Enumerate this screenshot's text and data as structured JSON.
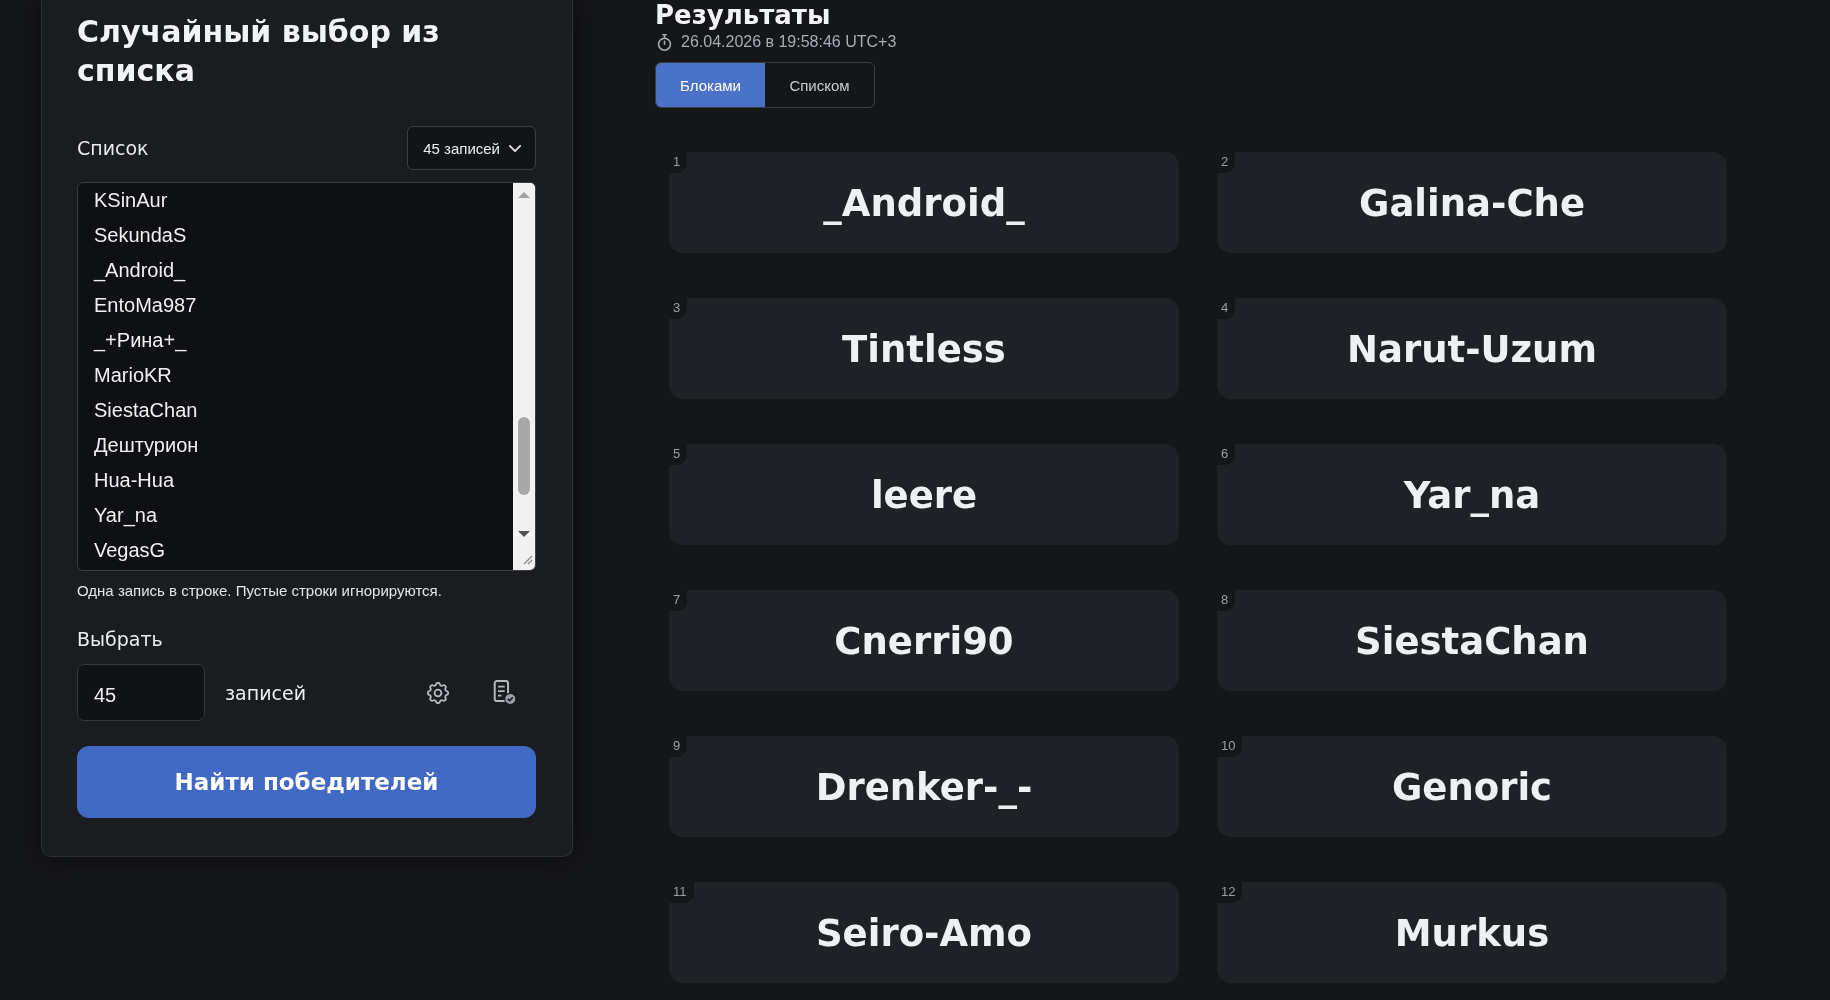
{
  "panel": {
    "title": "Случайный выбор из списка",
    "list_label": "Список",
    "count_dropdown": "45 записей",
    "entries": [
      "KSinAur",
      "SekundaS",
      "_Android_",
      "EntoMa987",
      "_+Рина+_",
      "MarioKR",
      "SiestaChan",
      "Дештурион",
      "Hua-Hua",
      "Yar_na",
      "VegasG"
    ],
    "hint": "Одна запись в строке. Пустые строки игнорируются.",
    "pick_label": "Выбрать",
    "pick_count": {
      "value": "45"
    },
    "pick_unit": "записей",
    "submit_button": "Найти победителей"
  },
  "results": {
    "title": "Результаты",
    "timestamp": "26.04.2026 в 19:58:46 UTC+3",
    "view_tabs": [
      {
        "label": "Блоками",
        "selected": true
      },
      {
        "label": "Списком",
        "selected": false
      }
    ],
    "winners": [
      {
        "number": "1",
        "name": "_Android_"
      },
      {
        "number": "2",
        "name": "Galina-Che"
      },
      {
        "number": "3",
        "name": "Tintless"
      },
      {
        "number": "4",
        "name": "Narut-Uzum"
      },
      {
        "number": "5",
        "name": "leere"
      },
      {
        "number": "6",
        "name": "Yar_na"
      },
      {
        "number": "7",
        "name": "Cnerri90"
      },
      {
        "number": "8",
        "name": "SiestaChan"
      },
      {
        "number": "9",
        "name": "Drenker-_-"
      },
      {
        "number": "10",
        "name": "Genoric"
      },
      {
        "number": "11",
        "name": "Seiro-Amo"
      },
      {
        "number": "12",
        "name": "Murkus"
      }
    ]
  }
}
